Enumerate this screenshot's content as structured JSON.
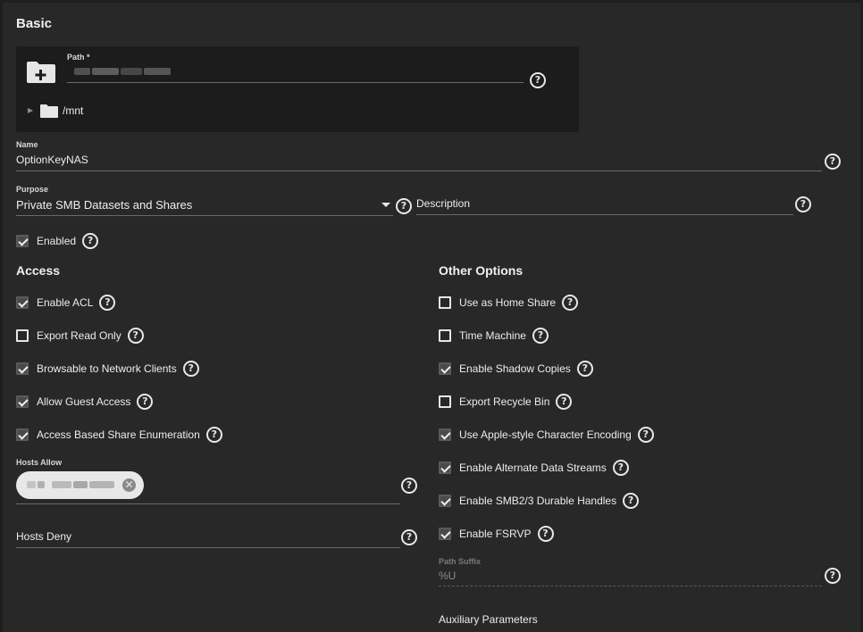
{
  "sections": {
    "basic": "Basic",
    "access": "Access",
    "other_options": "Other Options"
  },
  "path": {
    "label": "Path *",
    "tree_item": "/mnt",
    "expander": "▶"
  },
  "name": {
    "label": "Name",
    "value": "OptionKeyNAS"
  },
  "purpose": {
    "label": "Purpose",
    "value": "Private SMB Datasets and Shares"
  },
  "description": {
    "placeholder": "Description"
  },
  "enabled": {
    "label": "Enabled",
    "checked": true
  },
  "access_options": [
    {
      "label": "Enable ACL",
      "checked": true
    },
    {
      "label": "Export Read Only",
      "checked": false
    },
    {
      "label": "Browsable to Network Clients",
      "checked": true
    },
    {
      "label": "Allow Guest Access",
      "checked": true
    },
    {
      "label": "Access Based Share Enumeration",
      "checked": true
    }
  ],
  "hosts_allow": {
    "label": "Hosts Allow"
  },
  "hosts_deny": {
    "label": "Hosts Deny"
  },
  "other_options": [
    {
      "label": "Use as Home Share",
      "checked": false
    },
    {
      "label": "Time Machine",
      "checked": false
    },
    {
      "label": "Enable Shadow Copies",
      "checked": true
    },
    {
      "label": "Export Recycle Bin",
      "checked": false
    },
    {
      "label": "Use Apple-style Character Encoding",
      "checked": true
    },
    {
      "label": "Enable Alternate Data Streams",
      "checked": true
    },
    {
      "label": "Enable SMB2/3 Durable Handles",
      "checked": true
    },
    {
      "label": "Enable FSRVP",
      "checked": true
    }
  ],
  "path_suffix": {
    "label": "Path Suffix",
    "value": "%U"
  },
  "auxiliary": {
    "label": "Auxiliary Parameters"
  },
  "help_glyph": "?",
  "chip_remove_glyph": "✕",
  "colors": {
    "background": "#282828",
    "field_bg": "#1c1c1c",
    "text": "#e6e6e6"
  },
  "icons": {
    "add_folder": "folder-plus-icon",
    "folder": "folder-icon",
    "help": "help-circle-icon",
    "dropdown": "caret-down-icon",
    "chip_remove": "close-circle-icon"
  }
}
